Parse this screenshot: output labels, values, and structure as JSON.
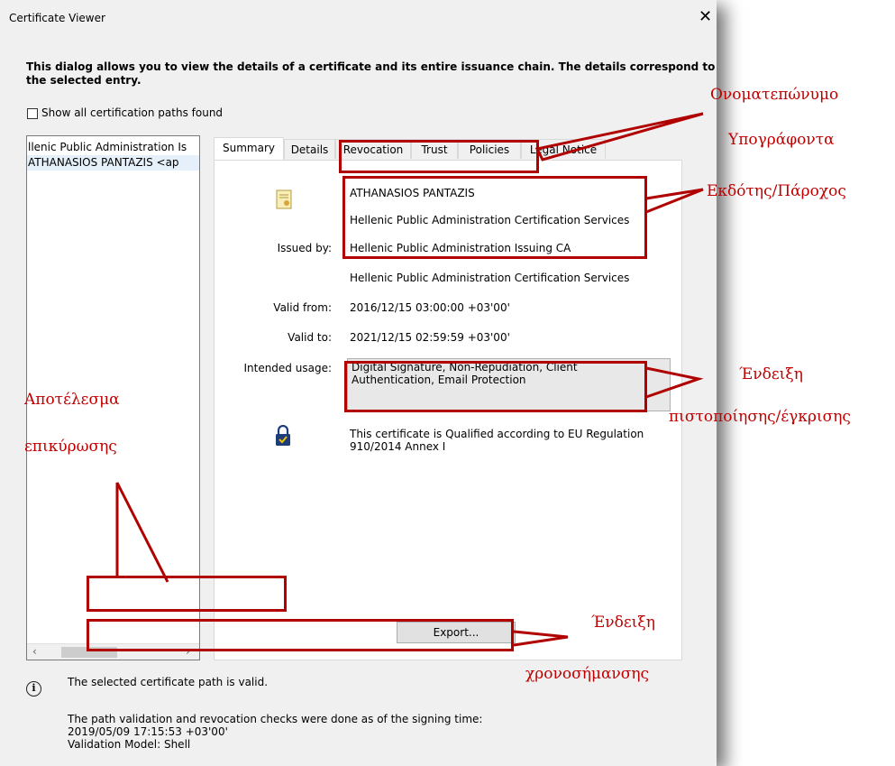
{
  "window": {
    "title": "Certificate Viewer",
    "close_glyph": "✕"
  },
  "intro": {
    "line1": "This dialog allows you to view the details of a certificate and its entire issuance chain. The details correspond to",
    "line2": "the selected entry."
  },
  "show_all_paths": {
    "label": "Show all certification paths found",
    "checked": false
  },
  "chain": {
    "items": [
      "llenic Public Administration Is",
      "ATHANASIOS PANTAZIS <ap"
    ],
    "scroll_left": "‹",
    "scroll_right": "›"
  },
  "tabs": [
    {
      "label": "Summary",
      "active": true
    },
    {
      "label": "Details",
      "active": false
    },
    {
      "label": "Revocation",
      "active": false
    },
    {
      "label": "Trust",
      "active": false
    },
    {
      "label": "Policies",
      "active": false
    },
    {
      "label": "Legal Notice",
      "active": false
    }
  ],
  "summary": {
    "subject_name": "ATHANASIOS PANTAZIS",
    "subject_org": "Hellenic Public Administration Certification Services",
    "issued_by_label": "Issued by:",
    "issuer_name": "Hellenic Public Administration Issuing CA",
    "issuer_org": "Hellenic Public Administration Certification Services",
    "valid_from_label": "Valid from:",
    "valid_from": "2016/12/15 03:00:00 +03'00'",
    "valid_to_label": "Valid to:",
    "valid_to": "2021/12/15 02:59:59 +03'00'",
    "usage_label": "Intended usage:",
    "usage_line1": "Digital Signature, Non-Repudiation, Client",
    "usage_line2": "Authentication, Email Protection",
    "qualified_line1": "This certificate is Qualified according to EU Regulation",
    "qualified_line2": "910/2014 Annex I",
    "export_label": "Export..."
  },
  "status": {
    "valid_text": "The selected certificate path is valid.",
    "checks_line1": "The path validation and revocation checks were done as of the signing time:",
    "checks_line2": "2019/05/09 17:15:53 +03'00'",
    "checks_line3": "Validation Model: Shell"
  },
  "annotations": {
    "signer_line1": "Ονοματεπώνυμο",
    "signer_line2": "Υπογράφοντα",
    "issuer": "Εκδότης/Πάροχος",
    "cert_line1": "Ένδειξη",
    "cert_line2": "πιστοποίησης/έγκρισης",
    "result_line1": "Αποτέλεσμα",
    "result_line2": "επικύρωσης",
    "ts_line1": "Ένδειξη",
    "ts_line2": "χρονοσήμανσης"
  },
  "colors": {
    "annotation": "#b00000",
    "dialog_bg": "#f0f0f0",
    "selection": "#e5f0fb"
  }
}
